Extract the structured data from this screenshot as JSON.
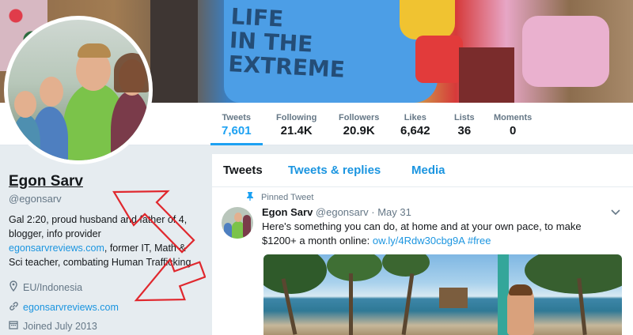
{
  "stats": [
    {
      "label": "Tweets",
      "value": "7,601",
      "active": true
    },
    {
      "label": "Following",
      "value": "21.4K",
      "active": false
    },
    {
      "label": "Followers",
      "value": "20.9K",
      "active": false
    },
    {
      "label": "Likes",
      "value": "6,642",
      "active": false
    },
    {
      "label": "Lists",
      "value": "36",
      "active": false
    },
    {
      "label": "Moments",
      "value": "0",
      "active": false
    }
  ],
  "banner": {
    "shirt_text": "LIFE\nIN THE\nEXTREME"
  },
  "profile": {
    "name": "Egon Sarv",
    "handle": "@egonsarv",
    "bio_1": "Gal 2:20, proud husband and father of 4, blogger, info provider ",
    "bio_link": "egonsarvreviews.com",
    "bio_2": ", former IT, Math & Sci teacher, combating Human Trafficking",
    "location": "EU/Indonesia",
    "website": "egonsarvreviews.com",
    "joined": "Joined July 2013"
  },
  "tabs": [
    {
      "label": "Tweets",
      "active": true
    },
    {
      "label": "Tweets & replies",
      "active": false
    },
    {
      "label": "Media",
      "active": false
    }
  ],
  "tweet": {
    "pinned_label": "Pinned Tweet",
    "name": "Egon Sarv",
    "handle": "@egonsarv",
    "separator": "·",
    "date": "May 31",
    "text": "Here's something you can do, at home and at your own pace, to make $1200+ a month online: ",
    "link": "ow.ly/4Rdw30cbg9A",
    "hashtag": "#free"
  },
  "icons": {
    "location": "map-pin-icon",
    "website": "link-icon",
    "joined": "calendar-icon",
    "pinned": "pin-icon",
    "caret": "chevron-down-icon"
  },
  "colors": {
    "accent": "#1da1f2",
    "link": "#1b95e0",
    "annotation": "#e0282e"
  }
}
